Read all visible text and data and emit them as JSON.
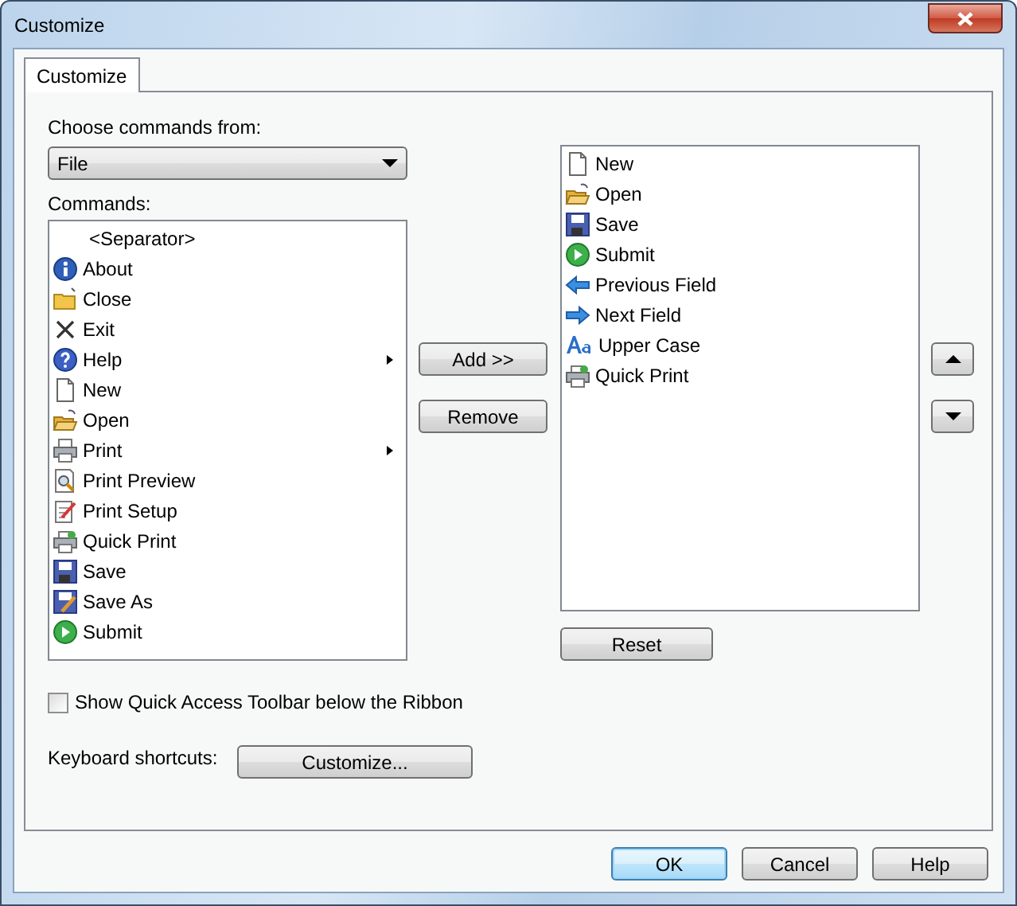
{
  "window": {
    "title": "Customize"
  },
  "tabs": [
    {
      "label": "Customize",
      "selected": true
    }
  ],
  "choose_label": "Choose commands from:",
  "category_dropdown": {
    "value": "File"
  },
  "commands_label": "Commands:",
  "commands": [
    {
      "label": "<Separator>",
      "kind": "separator",
      "submenu": false
    },
    {
      "label": "About",
      "kind": "info",
      "submenu": false
    },
    {
      "label": "Close",
      "kind": "folder",
      "submenu": false
    },
    {
      "label": "Exit",
      "kind": "cross",
      "submenu": false
    },
    {
      "label": "Help",
      "kind": "help",
      "submenu": true
    },
    {
      "label": "New",
      "kind": "page",
      "submenu": false
    },
    {
      "label": "Open",
      "kind": "open",
      "submenu": false
    },
    {
      "label": "Print",
      "kind": "printer",
      "submenu": true
    },
    {
      "label": "Print Preview",
      "kind": "preview",
      "submenu": false
    },
    {
      "label": "Print Setup",
      "kind": "setup",
      "submenu": false
    },
    {
      "label": "Quick Print",
      "kind": "quickprint",
      "submenu": false
    },
    {
      "label": "Save",
      "kind": "save",
      "submenu": false
    },
    {
      "label": "Save As",
      "kind": "saveas",
      "submenu": false
    },
    {
      "label": "Submit",
      "kind": "play",
      "submenu": false
    }
  ],
  "add_button": "Add >>",
  "remove_button": "Remove",
  "toolbar_commands": [
    {
      "label": "New",
      "kind": "page"
    },
    {
      "label": "Open",
      "kind": "open"
    },
    {
      "label": "Save",
      "kind": "save"
    },
    {
      "label": "Submit",
      "kind": "play"
    },
    {
      "label": "Previous Field",
      "kind": "left"
    },
    {
      "label": "Next Field",
      "kind": "right"
    },
    {
      "label": "Upper Case",
      "kind": "font"
    },
    {
      "label": "Quick Print",
      "kind": "quickprint"
    }
  ],
  "reset_button": "Reset",
  "below_ribbon": {
    "label": "Show Quick Access Toolbar below the Ribbon",
    "checked": false
  },
  "shortcuts_label": "Keyboard shortcuts:",
  "customize_button": "Customize...",
  "buttons": [
    {
      "label": "OK",
      "default": true
    },
    {
      "label": "Cancel",
      "default": false
    },
    {
      "label": "Help",
      "default": false
    }
  ]
}
